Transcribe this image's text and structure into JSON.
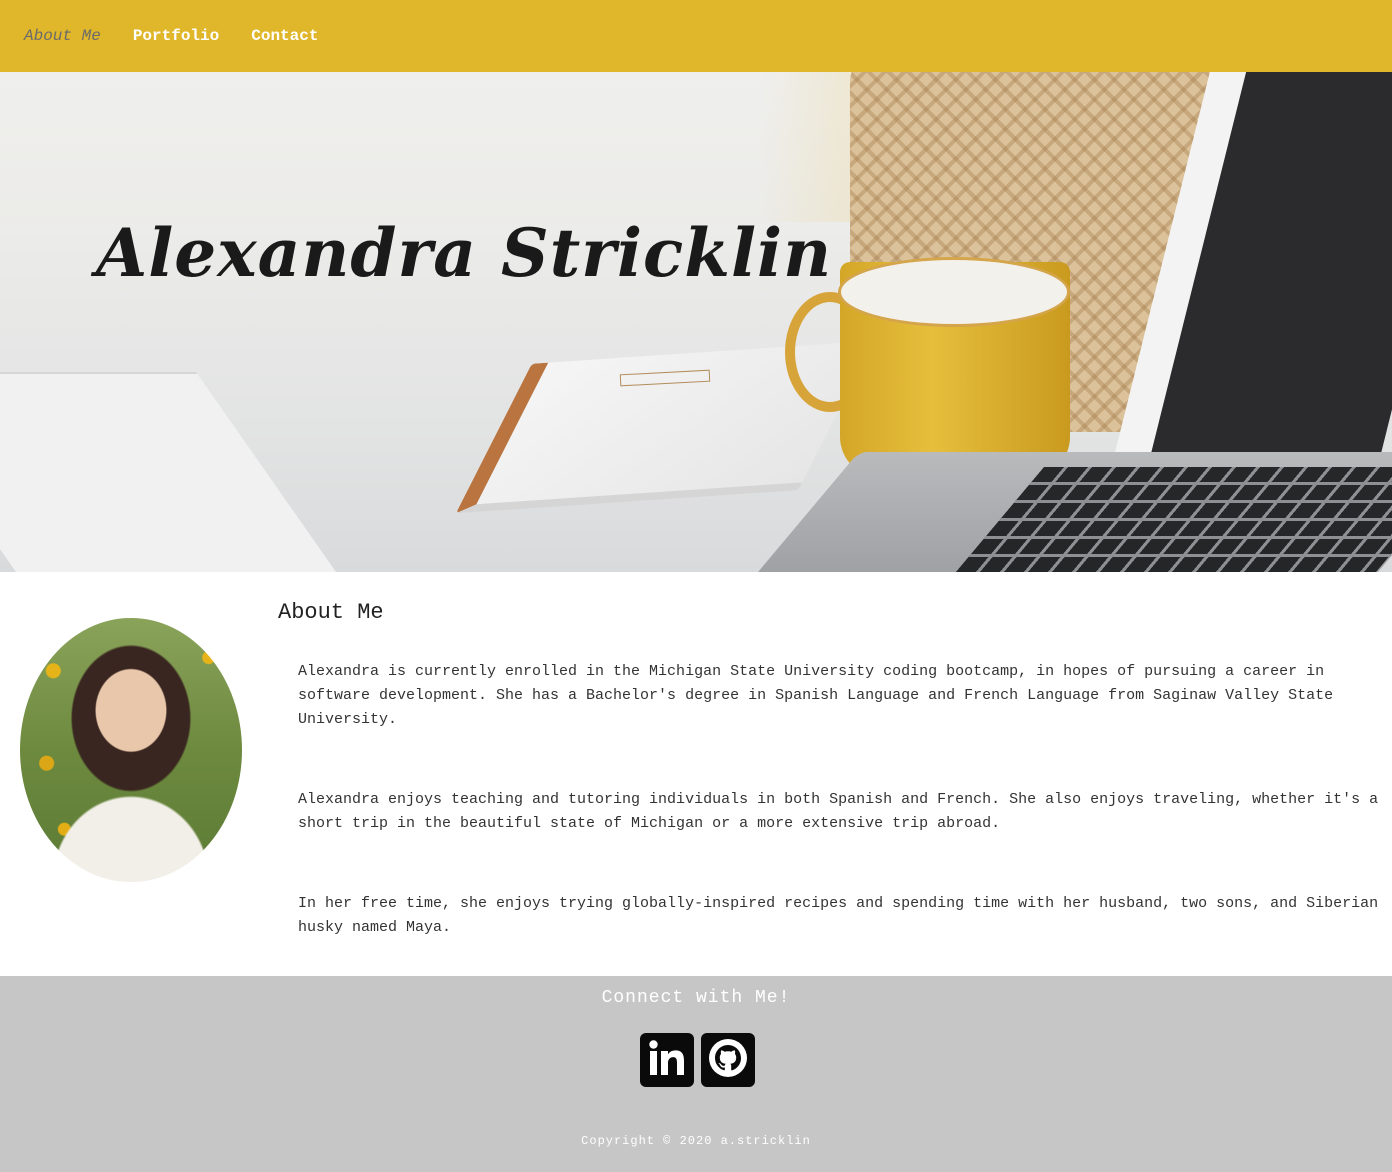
{
  "nav": {
    "items": [
      {
        "label": "About Me",
        "active": true
      },
      {
        "label": "Portfolio",
        "active": false
      },
      {
        "label": "Contact",
        "active": false
      }
    ]
  },
  "hero": {
    "title": "Alexandra Stricklin"
  },
  "about": {
    "heading": "About Me",
    "paragraphs": [
      "Alexandra is currently enrolled in the Michigan State University coding bootcamp, in hopes of pursuing a career in software development. She has a Bachelor's degree in Spanish Language and French Language from Saginaw Valley State University.",
      "Alexandra enjoys teaching and tutoring individuals in both Spanish and French. She also enjoys traveling, whether it's a short trip in the beautiful state of Michigan or a more extensive trip abroad.",
      "In her free time, she enjoys trying globally-inspired recipes and spending time with her husband, two sons, and Siberian husky named Maya."
    ]
  },
  "footer": {
    "heading": "Connect with Me!",
    "social": [
      {
        "icon": "linkedin-icon"
      },
      {
        "icon": "github-icon"
      }
    ],
    "copyright": "Copyright © 2020 a.stricklin"
  },
  "colors": {
    "nav_bg": "#e0b72b",
    "footer_bg": "#c6c6c6"
  }
}
